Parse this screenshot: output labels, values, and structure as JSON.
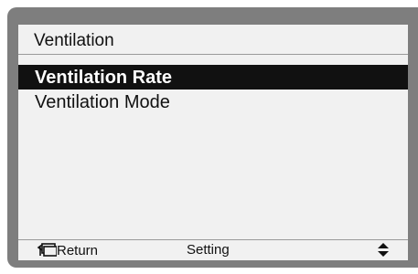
{
  "screen": {
    "title": "Ventilation"
  },
  "menu": {
    "items": [
      {
        "label": "Ventilation Rate",
        "selected": true
      },
      {
        "label": "Ventilation Mode",
        "selected": false
      }
    ]
  },
  "footer": {
    "return_label": "Return",
    "setting_label": "Setting",
    "return_icon": "return-icon",
    "updown_icon": "up-down-arrows-icon"
  },
  "colors": {
    "screen_background": "#f1f1f1",
    "highlight": "#111111",
    "bezel": "#7e7e7e"
  }
}
